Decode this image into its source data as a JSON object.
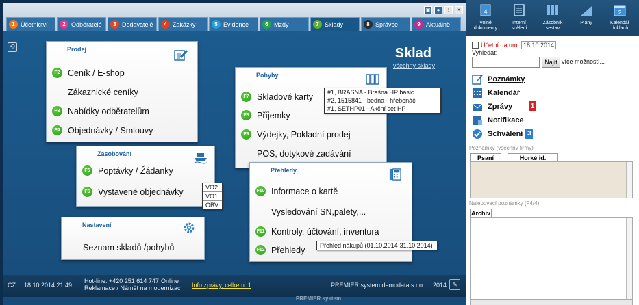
{
  "tabs": [
    {
      "num": "1",
      "label": "Účetnictví",
      "color": "#f07a1c"
    },
    {
      "num": "2",
      "label": "Odběratelé",
      "color": "#d83a8c"
    },
    {
      "num": "3",
      "label": "Dodavatelé",
      "color": "#e0481f"
    },
    {
      "num": "4",
      "label": "Zakázky",
      "color": "#d9421c"
    },
    {
      "num": "5",
      "label": "Evidence",
      "color": "#27a0d8"
    },
    {
      "num": "6",
      "label": "Mzdy",
      "color": "#2aa34a"
    },
    {
      "num": "7",
      "label": "Sklady",
      "color": "#5cb22e"
    },
    {
      "num": "8",
      "label": "Správce",
      "color": "#2c2c2c"
    },
    {
      "num": "9",
      "label": "Aktuálně",
      "color": "#c52b8f"
    }
  ],
  "header": {
    "title": "Sklad",
    "link": "všechny sklady"
  },
  "prodej": {
    "title": "Prodej",
    "items": [
      {
        "key": "F2",
        "label": "Ceník / E-shop"
      },
      {
        "key": "",
        "label": "Zákaznické ceníky"
      },
      {
        "key": "F3",
        "label": "Nabídky odběratelům"
      },
      {
        "key": "F4",
        "label": "Objednávky / Smlouvy"
      }
    ]
  },
  "zasobovani": {
    "title": "Zásobování",
    "items": [
      {
        "key": "F5",
        "label": "Poptávky / Žádanky"
      },
      {
        "key": "F6",
        "label": "Vystavené objednávky"
      }
    ],
    "popup": [
      "VO2",
      "VO1",
      "OBV"
    ]
  },
  "nastaveni": {
    "title": "Nastavení",
    "items": [
      {
        "key": "",
        "label": "Seznam skladů /pohybů"
      }
    ]
  },
  "pohyby": {
    "title": "Pohyby",
    "items": [
      {
        "key": "F7",
        "label": "Skladové karty"
      },
      {
        "key": "F8",
        "label": "Příjemky"
      },
      {
        "key": "F9",
        "label": "Výdejky, Pokladní prodej"
      },
      {
        "key": "",
        "label": "POS, dotykové zadávání"
      }
    ],
    "popup": [
      "#1, BRASNA - Brašna HP basic",
      "#2, 1515841 - bedna - hřebenáč",
      "#1, SETHP01 - Akční set HP"
    ]
  },
  "prehledy": {
    "title": "Přehledy",
    "items": [
      {
        "key": "F10",
        "label": "Informace o kartě"
      },
      {
        "key": "",
        "label": "Vysledování SN,palety,..."
      },
      {
        "key": "F11",
        "label": "Kontroly, účtování, inventura"
      },
      {
        "key": "F12",
        "label": "Přehledy"
      }
    ],
    "popup": "Přehled nákupů (01.10.2014-31.10.2014)"
  },
  "status": {
    "lang": "CZ",
    "datetime": "18.10.2014 21:49",
    "hotline": "Hot-line: +420 251 614 747",
    "online": "Online",
    "reklamace": "Reklamace / Námět na modernizaci",
    "info": "Info zprávy, celkem: 1",
    "company": "PREMIER system demodata s.r.o.",
    "year": "2014"
  },
  "bottom_logo": "PREMIER system",
  "sidebar": {
    "top": [
      {
        "label": "Volné dokumenty",
        "icon": "document-icon",
        "digit": "4"
      },
      {
        "label": "Interní sdělení",
        "icon": "message-icon",
        "digit": ""
      },
      {
        "label": "Zásobník sestav",
        "icon": "stack-icon",
        "digit": ""
      },
      {
        "label": "Plány",
        "icon": "chart-icon",
        "digit": ""
      },
      {
        "label": "Kalendář dokladů",
        "icon": "calendar-icon",
        "digit": "2"
      }
    ],
    "ucetni_datum_label": "Účetní datum:",
    "ucetni_datum_value": "18.10.2014",
    "search_label": "Vyhledat:",
    "search_button": "Najít",
    "more_link": "více možností...",
    "items": [
      {
        "label": "Poznámky",
        "icon": "notes-icon",
        "badge": ""
      },
      {
        "label": "Kalendář",
        "icon": "calendar-grid-icon",
        "badge": ""
      },
      {
        "label": "Zprávy",
        "icon": "mail-icon",
        "badge": "1"
      },
      {
        "label": "Notifikace",
        "icon": "notification-icon",
        "badge": ""
      },
      {
        "label": "Schválení",
        "icon": "check-icon",
        "badge": "3"
      }
    ],
    "badge_colors": {
      "red": "#d9202b",
      "blue": "#2b7fd6"
    },
    "notes_header": "Poznámky   (všechny firmy)",
    "note_tabs": [
      "Psaní",
      "Horké id."
    ],
    "pinned_header": "Nalepovací poznámky   (F4/4)",
    "pinned_tab": "Archív"
  }
}
